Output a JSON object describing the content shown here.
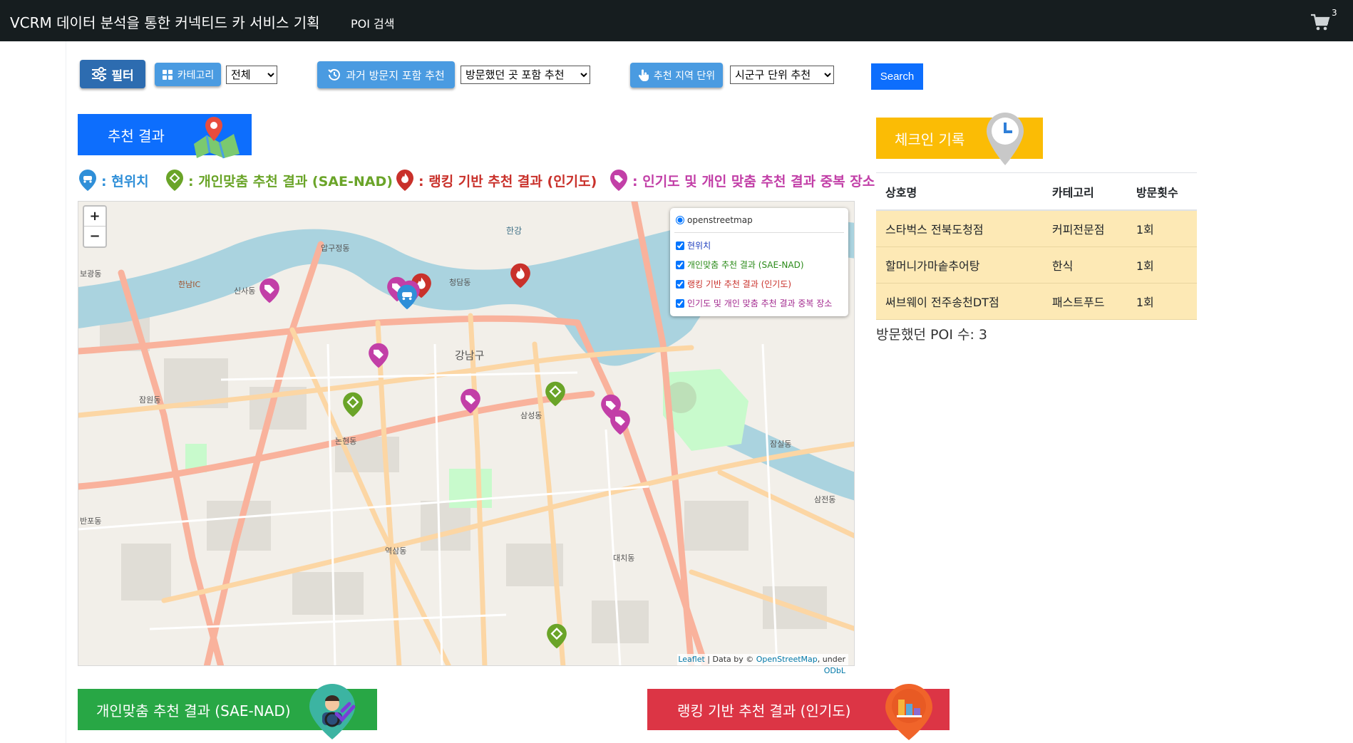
{
  "header": {
    "title": "VCRM 데이터 분석을 통한 커넥티드 카 서비스 기획",
    "nav_poi": "POI 검색",
    "cart_count": "3"
  },
  "filters": {
    "filter_label": "필터",
    "category_label": "카테고리",
    "category_selected": "전체",
    "past_label": "과거 방문지 포함 추천",
    "past_selected": "방문했던 곳 포함 추천",
    "region_label": "추천 지역 단위",
    "region_selected": "시군구 단위 추천",
    "search_label": "Search"
  },
  "recommend_header": "추천 결과",
  "checkin_header": "체크인 기록",
  "legend": {
    "current": ": 현위치",
    "personal": ": 개인맞춤 추천 결과 (SAE-NAD)",
    "ranking": ": 랭킹 기반 추천 결과 (인기도)",
    "overlap": ": 인기도 및 개인 맞춤 추천 결과 중복 장소"
  },
  "map": {
    "zoom_in": "+",
    "zoom_out": "−",
    "base_layer": "openstreetmap",
    "overlays": [
      "현위치",
      "개인맞춤 추천 결과 (SAE-NAD)",
      "랭킹 기반 추천 결과 (인기도)",
      "인기도 및 개인 맞춤 추천 결과 중복 장소"
    ],
    "attribution_leaflet": "Leaflet",
    "attribution_mid": " | Data by © ",
    "attribution_osm": "OpenStreetMap",
    "attribution_under": ", under ",
    "attribution_odbl": "ODbL",
    "district_label": "강남구",
    "river_label": "한강",
    "place_labels": [
      "압구정동",
      "신사동",
      "청담동",
      "삼성동",
      "논현동",
      "역삼동",
      "대치동",
      "잠원동",
      "반포동",
      "잠실동",
      "삼전동",
      "한남IC",
      "보광동"
    ]
  },
  "checkin_table": {
    "headers": [
      "상호명",
      "카테고리",
      "방문횟수"
    ],
    "rows": [
      [
        "스타벅스 전북도청점",
        "커피전문점",
        "1회"
      ],
      [
        "할머니가마솥추어탕",
        "한식",
        "1회"
      ],
      [
        "써브웨이 전주송천DT점",
        "패스트푸드",
        "1회"
      ]
    ]
  },
  "poi_count": "방문했던 POI 수: 3",
  "bottom": {
    "personal": "개인맞춤 추천 결과 (SAE-NAD)",
    "ranking": "랭킹 기반 추천 결과 (인기도)"
  },
  "colors": {
    "navbar": "#161d1f",
    "blue": "#0d6efd",
    "yellow": "#fbbc05",
    "green": "#28a745",
    "red": "#dc3545",
    "legend_current": "#2f8fd8",
    "legend_personal": "#6aa428",
    "legend_ranking": "#c9312b",
    "legend_overlap": "#c23fa7"
  }
}
